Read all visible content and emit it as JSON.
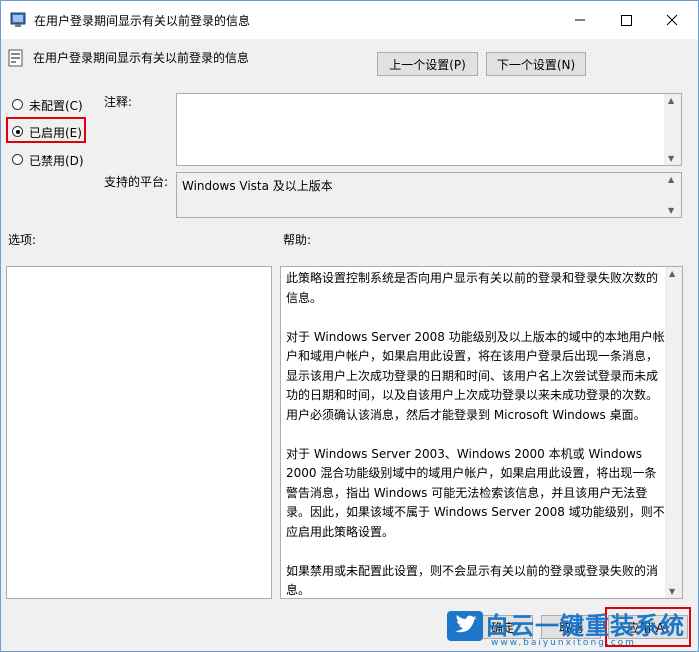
{
  "window": {
    "title": "在用户登录期间显示有关以前登录的信息",
    "minimize_symbol": "—",
    "close_symbol": "✕"
  },
  "header": {
    "policy_title": "在用户登录期间显示有关以前登录的信息",
    "prev_button": "上一个设置(P)",
    "next_button": "下一个设置(N)"
  },
  "state_options": [
    {
      "label": "未配置(C)",
      "selected": false
    },
    {
      "label": "已启用(E)",
      "selected": true
    },
    {
      "label": "已禁用(D)",
      "selected": false
    }
  ],
  "comment": {
    "label": "注释:",
    "value": ""
  },
  "platform": {
    "label": "支持的平台:",
    "value": "Windows Vista 及以上版本"
  },
  "options": {
    "label": "选项:"
  },
  "help": {
    "label": "帮助:",
    "paragraphs": [
      "此策略设置控制系统是否向用户显示有关以前的登录和登录失败次数的信息。",
      "对于 Windows Server 2008 功能级别及以上版本的域中的本地用户帐户和域用户帐户，如果启用此设置，将在该用户登录后出现一条消息，显示该用户上次成功登录的日期和时间、该用户名上次尝试登录而未成功的日期和时间，以及自该用户上次成功登录以来未成功登录的次数。用户必须确认该消息，然后才能登录到 Microsoft Windows 桌面。",
      "对于 Windows Server 2003、Windows 2000 本机或 Windows 2000 混合功能级别域中的域用户帐户，如果启用此设置，将出现一条警告消息，指出 Windows 可能无法检索该信息，并且该用户无法登录。因此，如果该域不属于 Windows Server 2008 域功能级别，则不应启用此策略设置。",
      "如果禁用或未配置此设置，则不会显示有关以前的登录或登录失败的消息。"
    ]
  },
  "footer": {
    "ok_button": "确定",
    "cancel_button": "取消",
    "apply_button": "应用(A)"
  },
  "watermark": {
    "title": "白云一键重装系统",
    "url": "www.baiyunxitong.com"
  },
  "colors": {
    "highlight": "#e0000b",
    "watermark": "#1d77c9"
  }
}
